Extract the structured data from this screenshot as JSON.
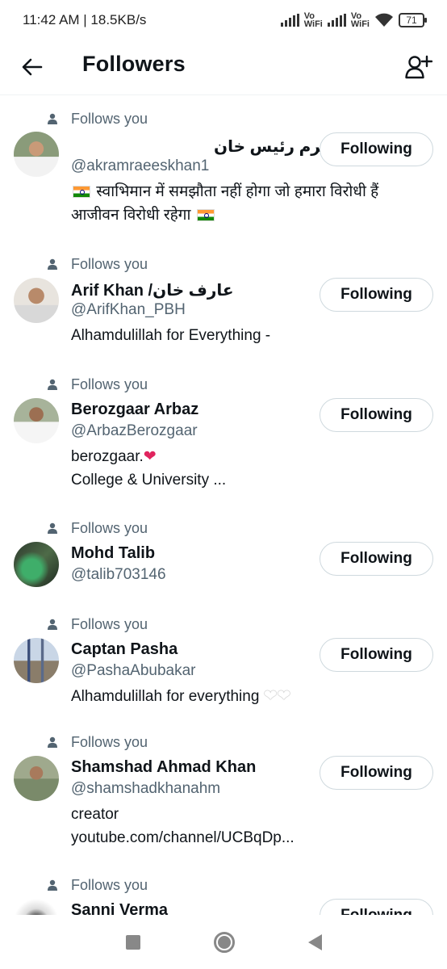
{
  "status_bar": {
    "time_speed": "11:42 AM | 18.5KB/s",
    "vowifi_label_top": "Vo",
    "vowifi_label_bottom": "WiFi",
    "battery": "71"
  },
  "header": {
    "title": "Followers"
  },
  "follows_you_label": "Follows you",
  "following_label": "Following",
  "followers": [
    {
      "name": "اکرم رئیس خان",
      "handle": "@akramraeeskhan1",
      "bio_line1": "स्वाभिमान में समझौता नहीं होगा जो हमारा विरोधी हैं",
      "bio_line2": "आजीवन विरोधी रहेगा"
    },
    {
      "name": "Arif Khan /عارف خان",
      "handle": "@ArifKhan_PBH",
      "bio_line1": "Alhamdulillah for Everything -"
    },
    {
      "name": "Berozgaar Arbaz",
      "handle": "@ArbazBerozgaar",
      "bio_line1": "berozgaar.",
      "bio_line2": "College & University ..."
    },
    {
      "name": "Mohd Talib",
      "handle": "@talib703146"
    },
    {
      "name": "Captan Pasha",
      "handle": "@PashaAbubakar",
      "bio_line1": "Alhamdulillah for everything"
    },
    {
      "name": "Shamshad Ahmad Khan",
      "handle": "@shamshadkhanahm",
      "bio_line1": "creator",
      "bio_line2": "youtube.com/channel/UCBqDp..."
    },
    {
      "name": "Sanni Verma"
    }
  ],
  "colors": {
    "text": "#0f1419",
    "secondary": "#536471",
    "border": "#cfd9de",
    "heart": "#e0245e"
  },
  "icons": {
    "back": "arrow-left-icon",
    "add_user": "person-plus-icon",
    "follows": "person-icon"
  }
}
